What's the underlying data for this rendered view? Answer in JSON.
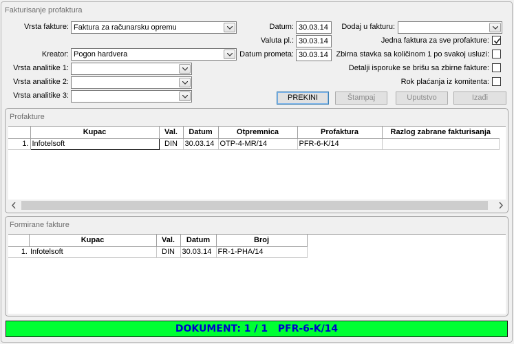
{
  "window": {
    "title": "Fakturisanje profaktura"
  },
  "form": {
    "vrsta_fakture": {
      "label": "Vrsta fakture:",
      "value": "Faktura za računarsku opremu"
    },
    "kreator": {
      "label": "Kreator:",
      "value": "Pogon hardvera"
    },
    "analitike1": {
      "label": "Vrsta analitike 1:",
      "value": ""
    },
    "analitike2": {
      "label": "Vrsta analitike 2:",
      "value": ""
    },
    "analitike3": {
      "label": "Vrsta analitike 3:",
      "value": ""
    },
    "datum": {
      "label": "Datum:",
      "value": "30.03.14"
    },
    "valuta": {
      "label": "Valuta pl.:",
      "value": "30.03.14"
    },
    "datum_prometa": {
      "label": "Datum prometa:",
      "value": "30.03.14"
    },
    "dodaj_u_fakturu": {
      "label": "Dodaj u fakturu:",
      "value": ""
    },
    "checks": [
      {
        "label": "Jedna faktura za sve profakture:",
        "checked": true
      },
      {
        "label": "Zbirna stavka sa količinom 1 po svakoj usluzi:",
        "checked": false
      },
      {
        "label": "Detalji isporuke se brišu sa zbirne fakture:",
        "checked": false
      },
      {
        "label": "Rok plaćanja iz komitenta:",
        "checked": false
      }
    ]
  },
  "buttons": {
    "prekini": "PREKINI",
    "stampaj": "Štampaj",
    "uputstvo": "Uputstvo",
    "izadji": "Izađi"
  },
  "profakture": {
    "title": "Profakture",
    "columns": [
      "Kupac",
      "Val.",
      "Datum",
      "Otpremnica",
      "Profaktura",
      "Razlog zabrane fakturisanja"
    ],
    "rows": [
      {
        "num": "1.",
        "kupac": "Infotelsoft",
        "val": "DIN",
        "datum": "30.03.14",
        "otpremnica": "OTP-4-MR/14",
        "profaktura": "PFR-6-K/14",
        "razlog": ""
      }
    ]
  },
  "formirane": {
    "title": "Formirane fakture",
    "columns": [
      "Kupac",
      "Val.",
      "Datum",
      "Broj"
    ],
    "rows": [
      {
        "num": "1.",
        "kupac": "Infotelsoft",
        "val": "DIN",
        "datum": "30.03.14",
        "broj": "FR-1-PHA/14"
      }
    ]
  },
  "status": {
    "text": "DOKUMENT: 1 / 1   PFR-6-K/14",
    "color": "#00ff33",
    "text_color": "#0000cc"
  }
}
